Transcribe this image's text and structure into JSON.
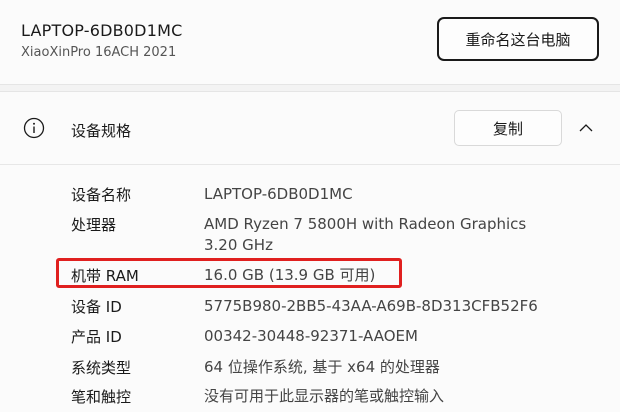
{
  "header": {
    "device_name": "LAPTOP-6DB0D1MC",
    "device_model": "XiaoXinPro 16ACH 2021",
    "rename_button": "重命名这台电脑"
  },
  "specs": {
    "title": "设备规格",
    "copy_button": "复制",
    "info_icon": "info-icon",
    "collapse_icon": "chevron-up-icon",
    "rows": [
      {
        "label": "设备名称",
        "value": "LAPTOP-6DB0D1MC"
      },
      {
        "label": "处理器",
        "value": "AMD Ryzen 7 5800H with Radeon Graphics",
        "value2": "3.20 GHz"
      },
      {
        "label": "机带 RAM",
        "value": "16.0 GB (13.9 GB 可用)"
      },
      {
        "label": "设备 ID",
        "value": "5775B980-2BB5-43AA-A69B-8D313CFB52F6"
      },
      {
        "label": "产品 ID",
        "value": "00342-30448-92371-AAOEM"
      },
      {
        "label": "系统类型",
        "value": "64 位操作系统, 基于 x64 的处理器"
      },
      {
        "label": "笔和触控",
        "value": "没有可用于此显示器的笔或触控输入"
      }
    ]
  },
  "colors": {
    "highlight": "#e0201f",
    "background": "#f3f3f3",
    "card": "#fbfbfb"
  }
}
